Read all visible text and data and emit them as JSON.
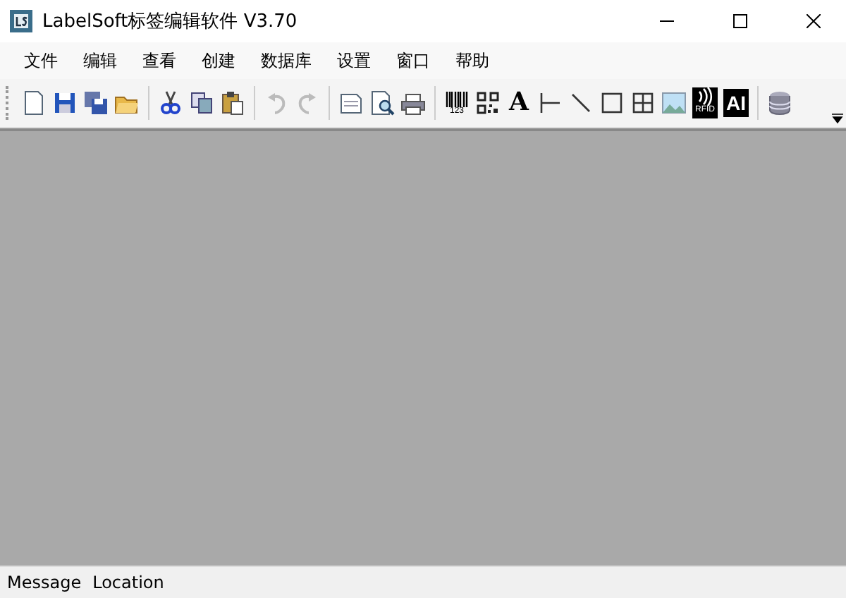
{
  "window": {
    "title": "LabelSoft标签编辑软件 V3.70"
  },
  "menu": [
    "文件",
    "编辑",
    "查看",
    "创建",
    "数据库",
    "设置",
    "窗口",
    "帮助"
  ],
  "toolbar": [
    [
      {
        "kind": "new",
        "disabled": false
      },
      {
        "kind": "save",
        "disabled": false
      },
      {
        "kind": "save-all",
        "disabled": false
      },
      {
        "kind": "open",
        "disabled": false
      }
    ],
    [
      {
        "kind": "cut",
        "disabled": false
      },
      {
        "kind": "copy",
        "disabled": false
      },
      {
        "kind": "paste",
        "disabled": false
      }
    ],
    [
      {
        "kind": "undo",
        "disabled": true
      },
      {
        "kind": "redo",
        "disabled": true
      }
    ],
    [
      {
        "kind": "page",
        "disabled": false
      },
      {
        "kind": "preview",
        "disabled": false
      },
      {
        "kind": "print",
        "disabled": false
      }
    ],
    [
      {
        "kind": "barcode",
        "label": "123",
        "disabled": false
      },
      {
        "kind": "qrcode",
        "disabled": false
      },
      {
        "kind": "text",
        "label": "A",
        "disabled": false
      },
      {
        "kind": "hline",
        "disabled": false
      },
      {
        "kind": "line",
        "disabled": false
      },
      {
        "kind": "rect",
        "disabled": false
      },
      {
        "kind": "table",
        "disabled": false
      },
      {
        "kind": "image",
        "disabled": false
      },
      {
        "kind": "rfid",
        "label": "RFID",
        "disabled": false
      },
      {
        "kind": "ai",
        "label": "AI",
        "disabled": false
      }
    ],
    [
      {
        "kind": "database",
        "disabled": false
      }
    ]
  ],
  "status_bar": [
    "Message",
    "Location"
  ]
}
